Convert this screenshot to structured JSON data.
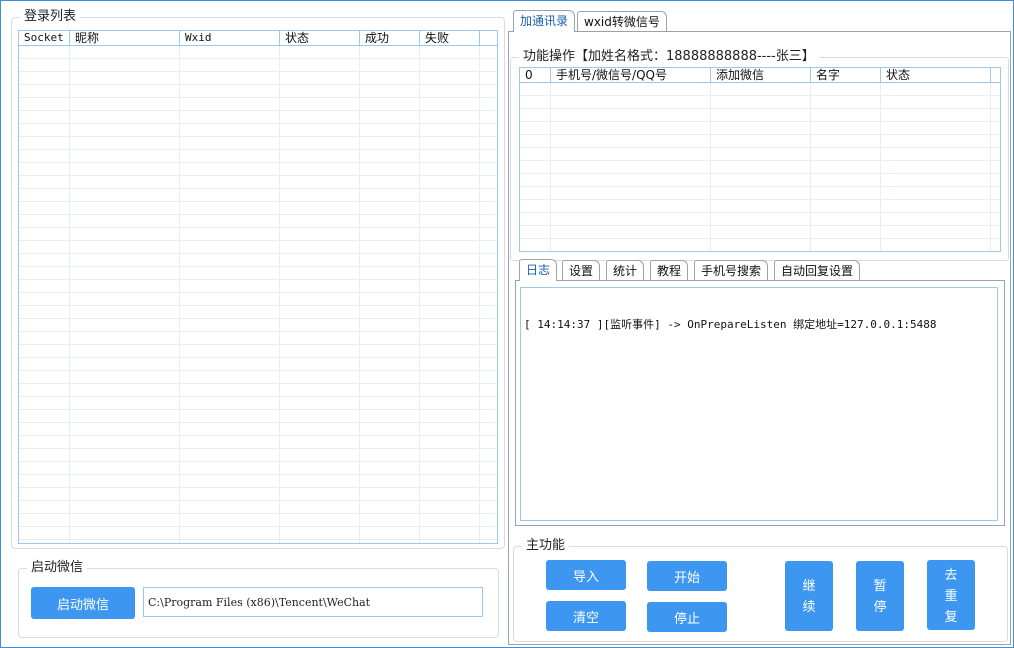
{
  "login_list": {
    "title": "登录列表",
    "columns": [
      "Socket",
      "昵称",
      "Wxid",
      "状态",
      "成功",
      "失败"
    ]
  },
  "start_wechat": {
    "title": "启动微信",
    "button_label": "启动微信",
    "path_value": "C:\\Program Files (x86)\\Tencent\\WeChat"
  },
  "top_tabs": [
    "加通讯录",
    "wxid转微信号"
  ],
  "function_ops": {
    "title": "功能操作【加姓名格式：18888888888----张三】",
    "columns": [
      "0",
      "手机号/微信号/QQ号",
      "添加微信",
      "名字",
      "状态"
    ]
  },
  "sub_tabs": [
    "日志",
    "设置",
    "统计",
    "教程",
    "手机号搜索",
    "自动回复设置"
  ],
  "log": {
    "lines": [
      "[ 14:14:37 ][监听事件] -> OnPrepareListen 绑定地址=127.0.0.1:5488"
    ]
  },
  "main_functions": {
    "title": "主功能",
    "import_label": "导入",
    "start_label": "开始",
    "clear_label": "清空",
    "stop_label": "停止",
    "continue_chars": [
      "继",
      "续"
    ],
    "pause_chars": [
      "暂",
      "停"
    ],
    "dedupe_chars": [
      "去",
      "重",
      "复"
    ]
  },
  "colors": {
    "accent": "#3d97f0",
    "grid_border": "#9cc8ee",
    "active_tab_text": "#1a5fb4"
  }
}
